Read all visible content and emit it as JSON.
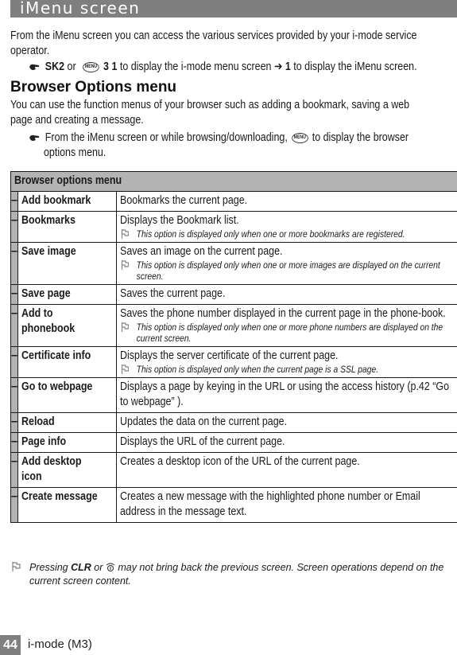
{
  "banner": {
    "title": "iMenu screen",
    "color": "#7f7f7f"
  },
  "intro": {
    "text": "From the iMenu screen you can access the various services provided by your i-mode service operator.",
    "step": {
      "bold1": "SK2",
      "or": " or ",
      "key_label": "MENU",
      "bold2": "3 1",
      "mid": " to display the i-mode menu screen ",
      "arrow": "➔",
      "bold3": "1",
      "tail": " to display the iMenu screen."
    }
  },
  "section": {
    "heading": "Browser Options menu",
    "text_line1": "You can use the function menus of your browser such as adding a bookmark, saving a web",
    "text_line2": "page and creating a message.",
    "step_line1_a": "From the iMenu screen or while browsing/downloading,",
    "step_key_label": "MENU",
    "step_line1_b": "to display the browser",
    "step_line2": "options menu."
  },
  "table": {
    "header": "Browser options menu",
    "dash": "–",
    "rows": [
      {
        "name": "Add bookmark",
        "desc": "Bookmarks the current page.",
        "note": ""
      },
      {
        "name": "Bookmarks",
        "desc": "Displays the Bookmark list.",
        "note": "This option is displayed only when one or more bookmarks are registered."
      },
      {
        "name": "Save image",
        "desc": "Saves an image on the current page.",
        "note": "This option is displayed only when one or more images are displayed on the current screen."
      },
      {
        "name": "Save page",
        "desc": "Saves the current page.",
        "note": ""
      },
      {
        "name": "Add to phonebook",
        "desc": "Saves the phone number displayed in the current page in the phone-book.",
        "note": "This option is displayed only when one or more phone numbers are displayed on the current screen."
      },
      {
        "name": "Certificate info",
        "desc": "Displays the server certificate of the current page.",
        "note": "This option is displayed only when the current page is a SSL page."
      },
      {
        "name": "Go to webpage",
        "desc": "Displays a page by keying in the URL or using the access history (p.42 “Go to webpage” ).",
        "note": ""
      },
      {
        "name": "Reload",
        "desc": "Updates the data on the current page.",
        "note": ""
      },
      {
        "name": "Page info",
        "desc": "Displays the URL of the current page.",
        "note": ""
      },
      {
        "name": "Add desktop icon",
        "desc": "Creates a desktop icon of the URL of the current page.",
        "note": ""
      },
      {
        "name": "Create message",
        "desc": "Creates a new message with the highlighted phone number or Email address in the message text.",
        "note": ""
      }
    ]
  },
  "footnote": {
    "pre": "Pressing ",
    "bold": "CLR",
    "mid": " or ",
    "post": " may not bring back the previous screen. Screen operations depend on the current screen content."
  },
  "footer": {
    "page_number": "44",
    "section": "i-mode (M3)"
  }
}
